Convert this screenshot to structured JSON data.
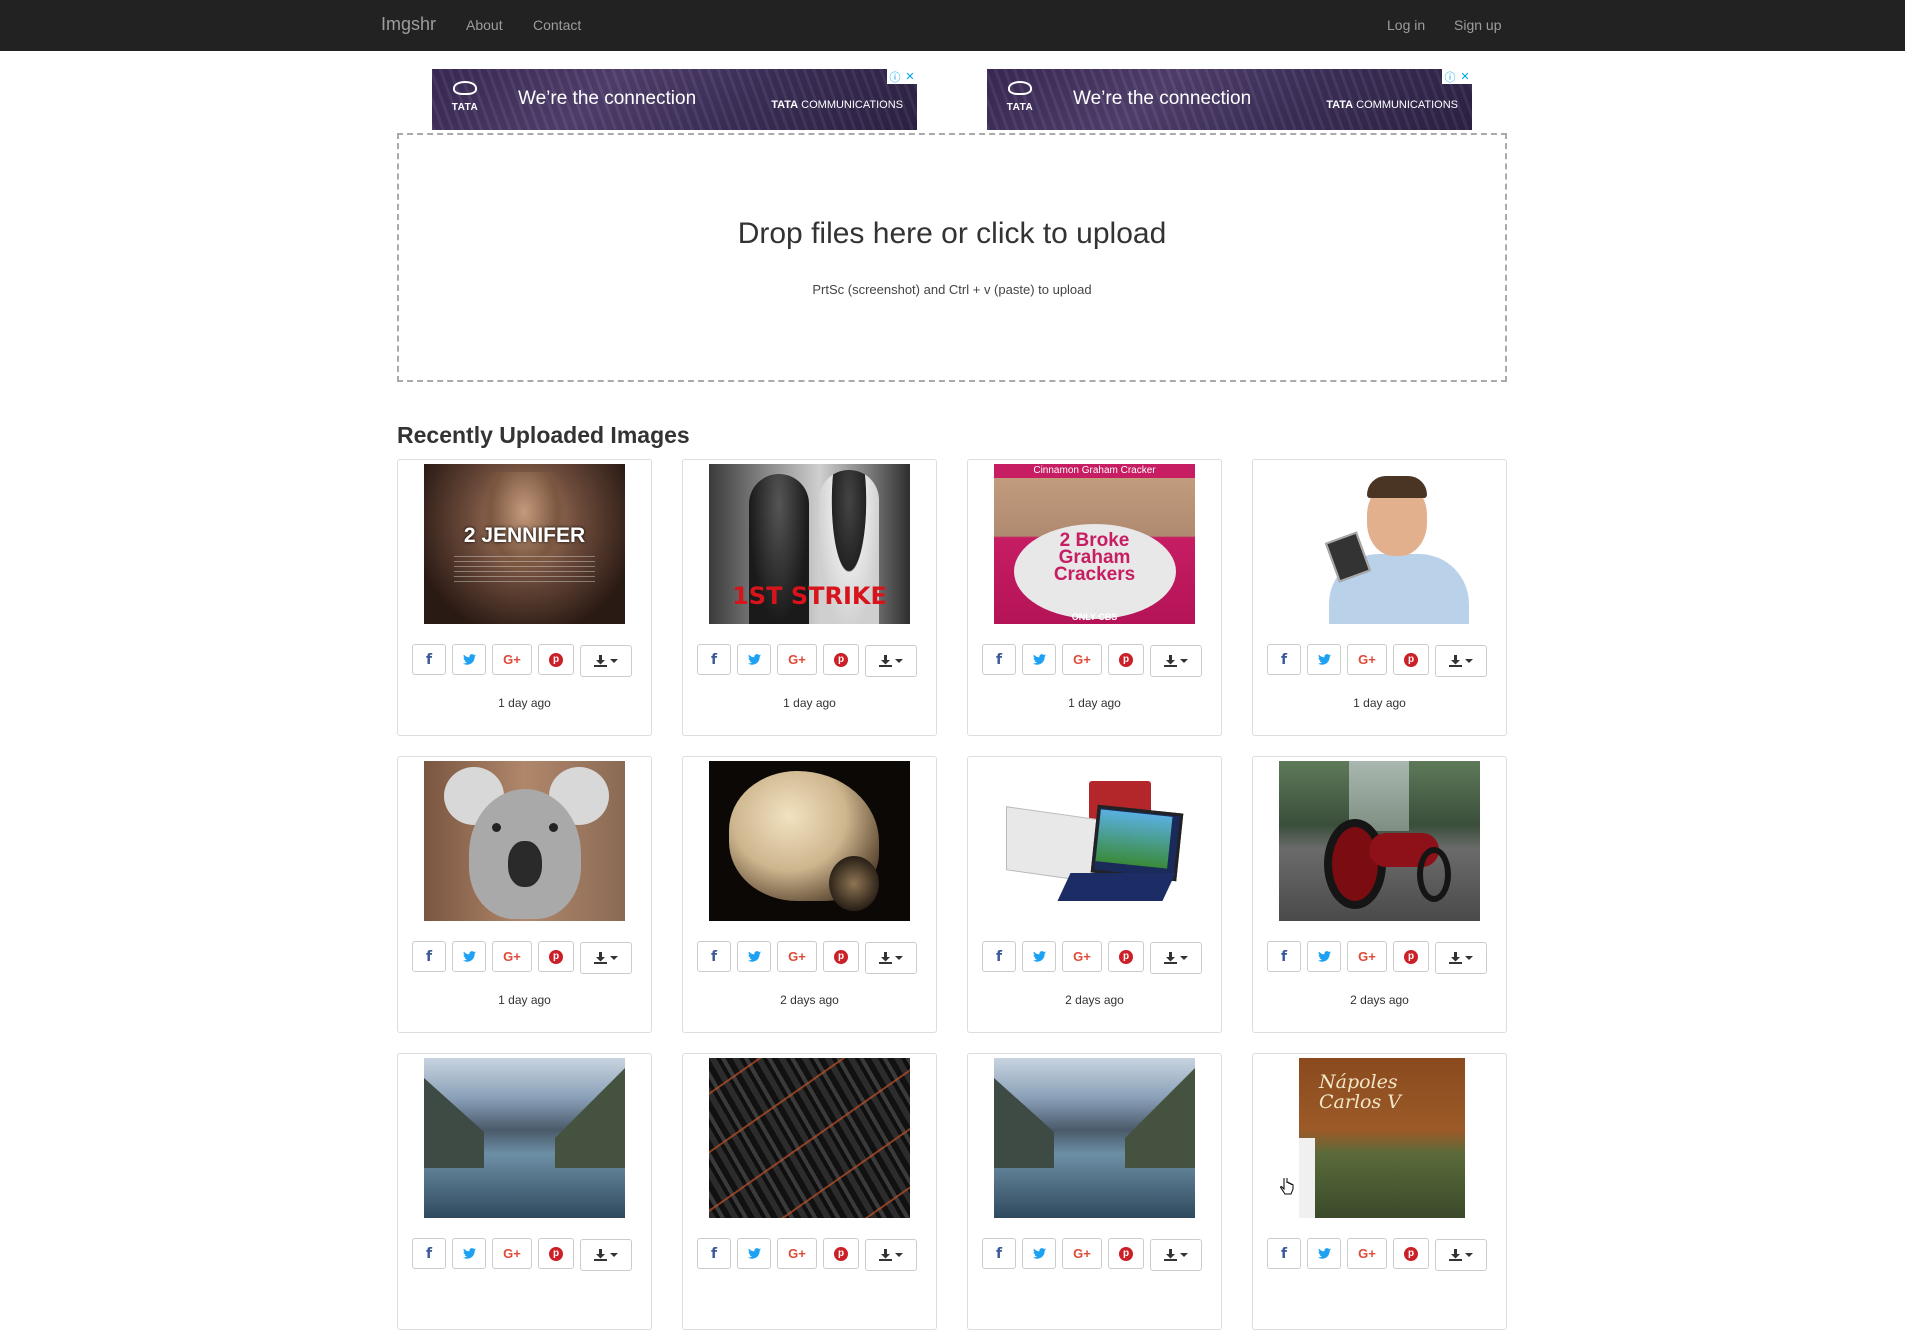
{
  "navbar": {
    "brand": "Imgshr",
    "about": "About",
    "contact": "Contact",
    "login": "Log in",
    "signup": "Sign up"
  },
  "ads": [
    {
      "logo_word": "TATA",
      "headline": "We’re the connection",
      "brand_a": "TATA",
      "brand_b": " COMMUNICATIONS"
    },
    {
      "logo_word": "TATA",
      "headline": "We’re the connection",
      "brand_a": "TATA",
      "brand_b": " COMMUNICATIONS"
    }
  ],
  "dropzone": {
    "title": "Drop files here or click to upload",
    "subtitle": "PrtSc (screenshot) and Ctrl + v (paste) to upload"
  },
  "recent": {
    "heading": "Recently Uploaded Images",
    "items": [
      {
        "image": "2 Jennifer movie poster",
        "poster_text": "2 JENNIFER",
        "time": "1 day ago"
      },
      {
        "image": "1st Strike movie poster",
        "poster_text": "1ST STRIKE",
        "time": "1 day ago"
      },
      {
        "image": "2 Broke Girls poster",
        "poster_top": "Cinnamon Graham Cracker",
        "poster_text": "2 Broke Graham Crackers",
        "poster_bottom": "ONLY CBS",
        "time": "1 day ago"
      },
      {
        "image": "stressed man with phone",
        "time": "1 day ago"
      },
      {
        "image": "koala",
        "time": "1 day ago"
      },
      {
        "image": "dog in dark",
        "time": "2 days ago"
      },
      {
        "image": "tablet and laptop",
        "time": "2 days ago"
      },
      {
        "image": "red motorcycle",
        "time": "2 days ago"
      },
      {
        "image": "mountain river",
        "time": ""
      },
      {
        "image": "bullets",
        "time": ""
      },
      {
        "image": "mountain river",
        "time": ""
      },
      {
        "image": "Napoles Carlos V book cover",
        "poster_text": "Nápoles Carlos V",
        "time": ""
      }
    ]
  },
  "icons": {
    "facebook": "facebook-icon",
    "twitter": "twitter-icon",
    "googleplus": "google-plus-icon",
    "pinterest": "pinterest-icon",
    "download": "download-icon"
  },
  "colors": {
    "navbar_bg": "#222222",
    "facebook": "#3b5998",
    "twitter": "#1da1f2",
    "googleplus": "#dd4b39",
    "pinterest": "#cb2027"
  }
}
